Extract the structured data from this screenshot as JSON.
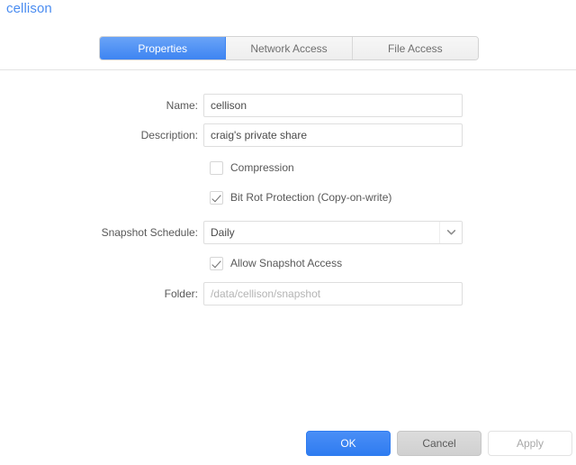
{
  "header": {
    "title": "cellison"
  },
  "tabs": [
    {
      "label": "Properties",
      "active": true
    },
    {
      "label": "Network Access",
      "active": false
    },
    {
      "label": "File Access",
      "active": false
    }
  ],
  "form": {
    "name": {
      "label": "Name:",
      "value": "cellison"
    },
    "description": {
      "label": "Description:",
      "value": "craig's private share"
    },
    "compression": {
      "label": "Compression",
      "checked": false
    },
    "bit_rot_protection": {
      "label": "Bit Rot Protection (Copy-on-write)",
      "checked": true
    },
    "snapshot_schedule": {
      "label": "Snapshot Schedule:",
      "value": "Daily",
      "options": [
        "Daily"
      ],
      "arrow_icon": "chevron-down-icon"
    },
    "allow_snapshot_access": {
      "label": "Allow Snapshot Access",
      "checked": true
    },
    "folder": {
      "label": "Folder:",
      "value": "/data/cellison/snapshot"
    }
  },
  "footer": {
    "ok_label": "OK",
    "cancel_label": "Cancel",
    "apply_label": "Apply"
  },
  "colors": {
    "accent": "#3d84f2",
    "title": "#4a8cf0",
    "label_text": "#585858",
    "muted_text": "#b4b4b4",
    "border": "#dedede"
  }
}
